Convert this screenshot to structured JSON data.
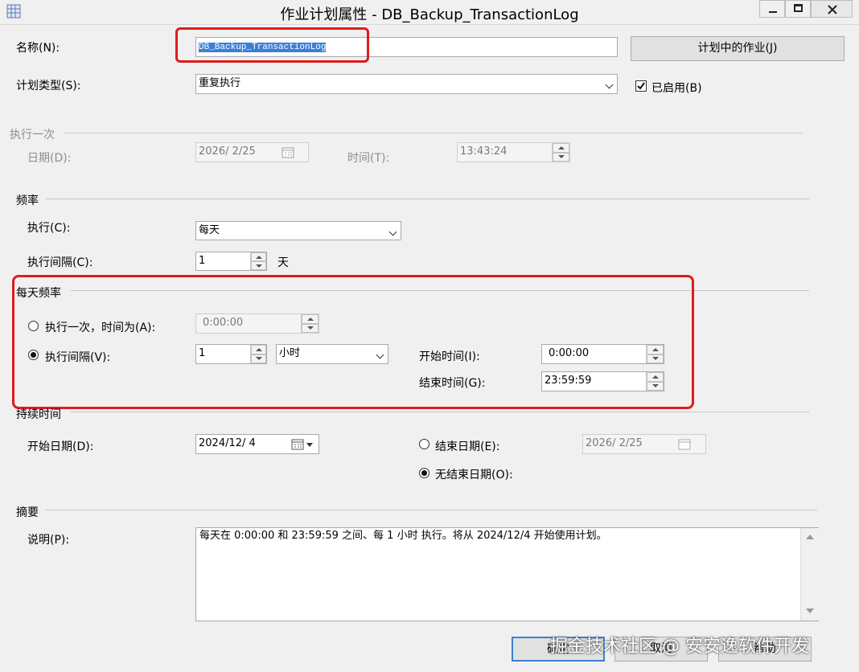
{
  "window": {
    "title": "作业计划属性 - DB_Backup_TransactionLog",
    "controls": [
      "minimize-button",
      "maximize-button",
      "close-button"
    ]
  },
  "general": {
    "name_label": "名称(N):",
    "name_value": "DB_Backup_TransactionLog",
    "jobs_in_schedule_button": "计划中的作业(J)",
    "schedule_type_label": "计划类型(S):",
    "schedule_type_value": "重复执行",
    "enabled_label": "已启用(B)",
    "enabled_checked": true
  },
  "one_time": {
    "group_label": "执行一次",
    "date_label": "日期(D):",
    "date_value": "2026/ 2/25",
    "time_label": "时间(T):",
    "time_value": "13:43:24"
  },
  "frequency": {
    "group_label": "频率",
    "occurs_label": "执行(C):",
    "occurs_value": "每天",
    "recurs_every_label": "执行间隔(C):",
    "recurs_every_value": "1",
    "recurs_every_unit": "天"
  },
  "daily_frequency": {
    "group_label": "每天频率",
    "once_label": "执行一次，时间为(A):",
    "once_value": "0:00:00",
    "every_label": "执行间隔(V):",
    "every_value": "1",
    "every_unit_value": "小时",
    "start_time_label": "开始时间(I):",
    "start_time_value": "0:00:00",
    "end_time_label": "结束时间(G):",
    "end_time_value": "23:59:59",
    "selected_option": "every"
  },
  "duration": {
    "group_label": "持续时间",
    "start_date_label": "开始日期(D):",
    "start_date_value": "2024/12/ 4",
    "end_date_label": "结束日期(E):",
    "end_date_value": "2026/ 2/25",
    "no_end_date_label": "无结束日期(O):",
    "selected_option": "no_end_date"
  },
  "summary": {
    "group_label": "摘要",
    "description_label": "说明(P):",
    "description_text": "每天在 0:00:00 和 23:59:59 之间、每 1 小时 执行。将从 2024/12/4 开始使用计划。"
  },
  "footer": {
    "ok_button": "确定",
    "cancel_button": "取消",
    "help_button": "帮助"
  },
  "watermark": "掘金技术社区 @ 安安逸软件开发",
  "colors": {
    "highlight_red": "#e01b1b",
    "selection_blue": "#3b7fd9"
  }
}
